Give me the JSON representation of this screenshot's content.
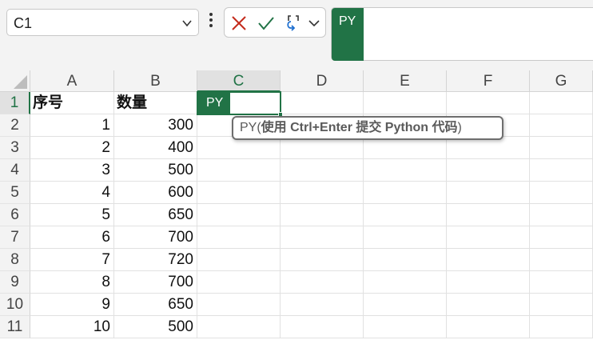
{
  "formula_bar": {
    "name_box": "C1",
    "cancel_icon": "close-icon",
    "enter_icon": "check-icon",
    "insert_icon": "python-insert-icon",
    "py_badge": "PY"
  },
  "columns": [
    "A",
    "B",
    "C",
    "D",
    "E",
    "F",
    "G"
  ],
  "rows": [
    "1",
    "2",
    "3",
    "4",
    "5",
    "6",
    "7",
    "8",
    "9",
    "10",
    "11"
  ],
  "sheet": {
    "A": [
      "序号",
      "1",
      "2",
      "3",
      "4",
      "5",
      "6",
      "7",
      "8",
      "9",
      "10"
    ],
    "B": [
      "数量",
      "300",
      "400",
      "500",
      "600",
      "650",
      "700",
      "720",
      "700",
      "650",
      "500"
    ]
  },
  "active_cell": {
    "ref": "C1",
    "py_chip": "PY"
  },
  "tooltip": {
    "prefix": "PY(",
    "hint": "使用 Ctrl+Enter 提交 Python 代码",
    "suffix": ")"
  },
  "colors": {
    "accent": "#217346"
  }
}
